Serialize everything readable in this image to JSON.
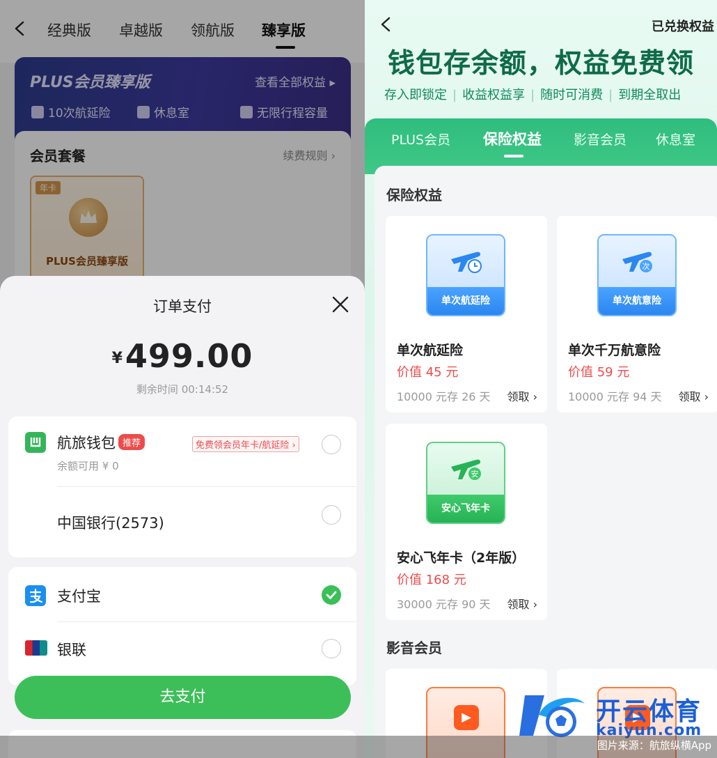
{
  "left": {
    "tabs": [
      {
        "label": "经典版"
      },
      {
        "label": "卓越版"
      },
      {
        "label": "领航版"
      },
      {
        "label": "臻享版"
      }
    ],
    "plus_card": {
      "title": "PLUS会员臻享版",
      "view_all": "查看全部权益 ▸",
      "features": [
        "10次航延险",
        "休息室",
        "无限行程容量"
      ]
    },
    "package": {
      "title": "会员套餐",
      "rules": "续费规则 ›",
      "item_badge": "年卡",
      "item_name": "PLUS会员臻享版"
    },
    "sheet": {
      "title": "订单支付",
      "currency": "¥",
      "amount": "499.00",
      "remaining": "剩余时间 00:14:52",
      "methods": [
        {
          "name": "航旅钱包",
          "tag": "推荐",
          "promo": "免费领会员年卡/航延险 ›",
          "sub": "余额可用 ¥ 0",
          "selected": false
        },
        {
          "name": "中国银行(2573)",
          "selected": false
        },
        {
          "name": "支付宝",
          "selected": true
        },
        {
          "name": "银联",
          "selected": false
        }
      ],
      "pay_button": "去支付"
    }
  },
  "right": {
    "redeemed": "已兑换权益",
    "headline": "钱包存余额，权益免费领",
    "points": [
      "存入即锁定",
      "收益权益享",
      "随时可消费",
      "到期全取出"
    ],
    "tabs": [
      {
        "label": "PLUS会员"
      },
      {
        "label": "保险权益"
      },
      {
        "label": "影音会员"
      },
      {
        "label": "休息室"
      }
    ],
    "insurance": {
      "section_title": "保险权益",
      "cards": [
        {
          "art_label": "单次航延险",
          "name": "单次航延险",
          "value": "价值 45 元",
          "condition": "10000 元存 26 天",
          "claim": "领取 ›",
          "art_badge": ""
        },
        {
          "art_label": "单次航意险",
          "name": "单次千万航意险",
          "value": "价值 59 元",
          "condition": "10000 元存 94 天",
          "claim": "领取 ›",
          "art_badge": "次"
        },
        {
          "art_label": "安心飞年卡",
          "name": "安心飞年卡（2年版）",
          "value": "价值 168 元",
          "condition": "30000 元存 90 天",
          "claim": "领取 ›",
          "art_badge": "安"
        }
      ]
    },
    "media": {
      "section_title": "影音会员"
    }
  },
  "watermark": {
    "brand": "开云体育",
    "domain": "kaiyun.com"
  },
  "caption": "图片来源：航旅纵横App",
  "colors": {
    "primary_green": "#3cbf58",
    "teal_green": "#2fbd7e",
    "price_red": "#ef4a4a",
    "plus_navy": "#2e3d8f"
  }
}
